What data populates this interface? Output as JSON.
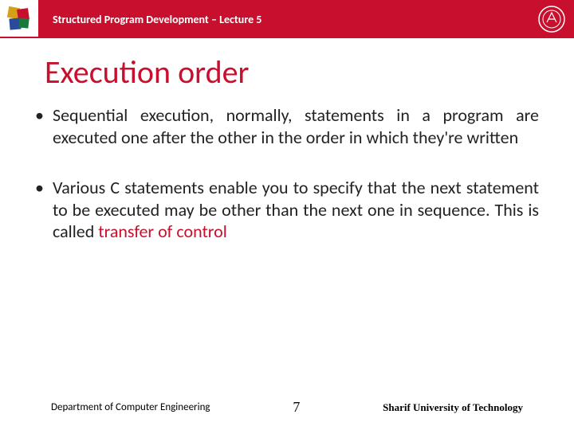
{
  "header": {
    "title": "Structured Program Development – Lecture 5"
  },
  "slide": {
    "title": "Execution order",
    "bullets": [
      {
        "pre": "Sequential execution, normally, statements in a program are executed one after the other in the order in which they're written",
        "highlight": "",
        "post": ""
      },
      {
        "pre": "Various C statements enable you to specify that the next statement to be executed may be other than the next one in sequence. This is called ",
        "highlight": "transfer of control",
        "post": ""
      }
    ]
  },
  "footer": {
    "left": "Department of Computer Engineering",
    "page": "7",
    "right": "Sharif University of Technology"
  }
}
